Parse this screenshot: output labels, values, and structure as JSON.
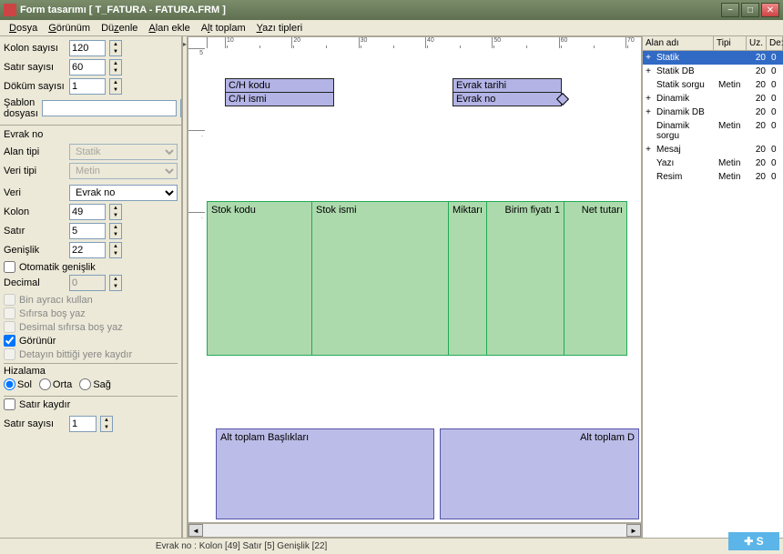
{
  "window": {
    "title": "Form tasarımı [ T_FATURA - FATURA.FRM ]"
  },
  "menu": {
    "dosya": "Dosya",
    "gorunum": "Görünüm",
    "duzenle": "Düzenle",
    "alan_ekle": "Alan ekle",
    "alt_toplam": "Alt toplam",
    "yazi_tipleri": "Yazı tipleri"
  },
  "left": {
    "kolon_sayisi_label": "Kolon sayısı",
    "kolon_sayisi": "120",
    "satir_sayisi_label": "Satır sayısı",
    "satir_sayisi": "60",
    "dokum_sayisi_label": "Döküm sayısı",
    "dokum_sayisi": "1",
    "sablon_label": "Şablon dosyası",
    "sablon": "",
    "evrak_title": "Evrak no",
    "alan_tipi_label": "Alan tipi",
    "alan_tipi": "Statik",
    "veri_tipi_label": "Veri tipi",
    "veri_tipi": "Metin",
    "veri_label": "Veri",
    "veri": "Evrak no",
    "kolon_label": "Kolon",
    "kolon": "49",
    "satir_label": "Satır",
    "satir": "5",
    "genislik_label": "Genişlik",
    "genislik": "22",
    "otomatik": "Otomatik genişlik",
    "decimal_label": "Decimal",
    "decimal": "0",
    "bin_ayraci": "Bin ayracı kullan",
    "sifirsa": "Sıfırsa boş yaz",
    "desimal_sifirsa": "Desimal sıfırsa boş yaz",
    "gorunur": "Görünür",
    "detayin": "Detayın bittiği yere kaydır",
    "hizalama": "Hizalama",
    "sol": "Sol",
    "orta": "Orta",
    "sag": "Sağ",
    "satir_kaydir": "Satır kaydır",
    "satir_sayisi2_label": "Satır sayısı",
    "satir_sayisi2": "1"
  },
  "canvas": {
    "ch_kodu": "C/H kodu",
    "ch_ismi": "C/H ismi",
    "evrak_tarihi": "Evrak tarihi",
    "evrak_no": "Evrak no",
    "cols": {
      "stok_kodu": "Stok kodu",
      "stok_ismi": "Stok ismi",
      "miktar": "Miktarı",
      "birim_fiyat": "Birim fiyatı 1",
      "net_tutari": "Net tutarı"
    },
    "footer": {
      "left": "Alt toplam Başlıkları",
      "right": "Alt toplam D"
    }
  },
  "right": {
    "hdr_alan": "Alan adı",
    "hdr_tipi": "Tipi",
    "hdr_uz": "Uz.",
    "hdr_de": "De:",
    "rows": [
      {
        "exp": "+",
        "name": "Statik",
        "tipi": "",
        "uz": "20",
        "de": "0",
        "sel": true
      },
      {
        "exp": "+",
        "name": "Statik DB",
        "tipi": "",
        "uz": "20",
        "de": "0"
      },
      {
        "exp": "",
        "name": "Statik sorgu",
        "tipi": "Metin",
        "uz": "20",
        "de": "0"
      },
      {
        "exp": "+",
        "name": "Dinamik",
        "tipi": "",
        "uz": "20",
        "de": "0"
      },
      {
        "exp": "+",
        "name": "Dinamik DB",
        "tipi": "",
        "uz": "20",
        "de": "0"
      },
      {
        "exp": "",
        "name": "Dinamik sorgu",
        "tipi": "Metin",
        "uz": "20",
        "de": "0"
      },
      {
        "exp": "+",
        "name": "Mesaj",
        "tipi": "",
        "uz": "20",
        "de": "0"
      },
      {
        "exp": "",
        "name": "Yazı",
        "tipi": "Metin",
        "uz": "20",
        "de": "0"
      },
      {
        "exp": "",
        "name": "Resim",
        "tipi": "Metin",
        "uz": "20",
        "de": "0"
      }
    ]
  },
  "status": "Evrak no  : Kolon [49]   Satır [5]   Genişlik [22]"
}
